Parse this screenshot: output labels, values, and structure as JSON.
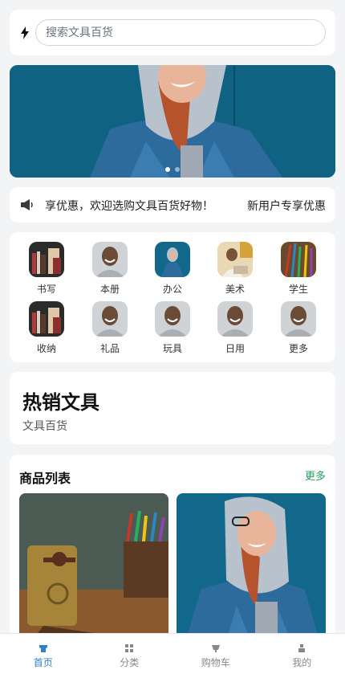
{
  "search": {
    "placeholder": "搜索文具百货"
  },
  "banner": {
    "dots": 2,
    "active_dot": 1
  },
  "notice": {
    "text": "享优惠，欢迎选购文具百货好物！",
    "promo": "新用户专享优惠"
  },
  "categories": [
    {
      "label": "书写"
    },
    {
      "label": "本册"
    },
    {
      "label": "办公"
    },
    {
      "label": "美术"
    },
    {
      "label": "学生"
    },
    {
      "label": "收纳"
    },
    {
      "label": "礼品"
    },
    {
      "label": "玩具"
    },
    {
      "label": "日用"
    },
    {
      "label": "更多"
    }
  ],
  "hot": {
    "title": "热销文具",
    "subtitle": "文具百货"
  },
  "products": {
    "heading": "商品列表",
    "more": "更多"
  },
  "tabbar": {
    "active": 0,
    "items": [
      {
        "label": "首页"
      },
      {
        "label": "分类"
      },
      {
        "label": "购物车"
      },
      {
        "label": "我的"
      }
    ]
  },
  "colors": {
    "accent": "#2f80c8",
    "more_link": "#22a05a"
  }
}
